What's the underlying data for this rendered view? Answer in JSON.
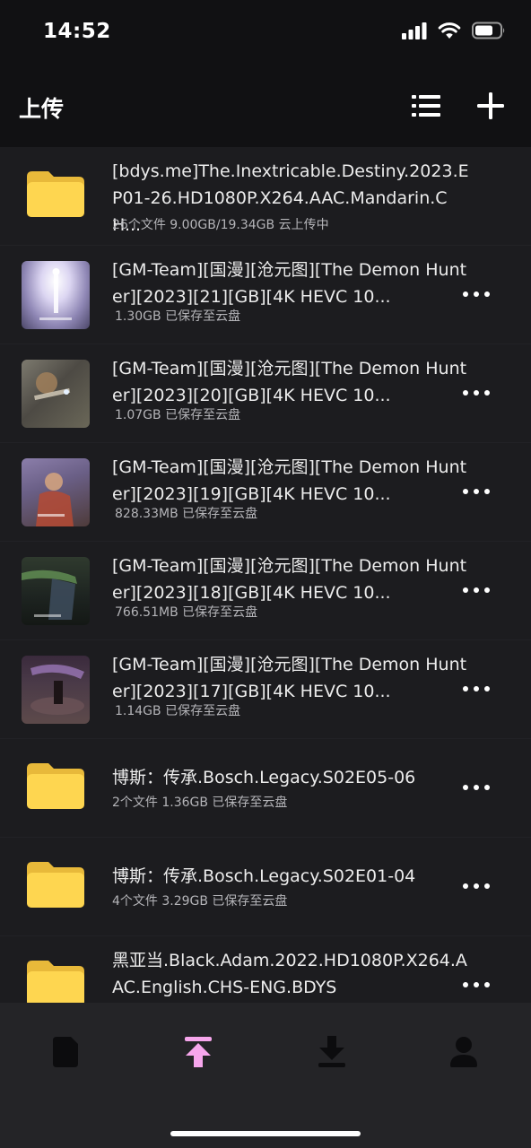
{
  "status_bar": {
    "time": "14:52"
  },
  "header": {
    "title": "上传"
  },
  "colors": {
    "accent": "#f6a6ec",
    "folder": "#fed650",
    "background": "#111113",
    "row": "#1c1c1f",
    "tabbar": "#242427"
  },
  "items": [
    {
      "type": "folder",
      "name": "[bdys.me]The.Inextricable.Destiny.2023.EP01-26.HD1080P.X264.AAC.Mandarin.CH...",
      "meta": "26个文件 9.00GB/19.34GB 云上传中"
    },
    {
      "type": "video",
      "name": "[GM-Team][国漫][沧元图][The Demon Hunter][2023][21][GB][4K HEVC 10...",
      "meta": "1.30GB 已保存至云盘"
    },
    {
      "type": "video",
      "name": "[GM-Team][国漫][沧元图][The Demon Hunter][2023][20][GB][4K HEVC 10...",
      "meta": "1.07GB 已保存至云盘"
    },
    {
      "type": "video",
      "name": "[GM-Team][国漫][沧元图][The Demon Hunter][2023][19][GB][4K HEVC 10...",
      "meta": "828.33MB 已保存至云盘"
    },
    {
      "type": "video",
      "name": "[GM-Team][国漫][沧元图][The Demon Hunter][2023][18][GB][4K HEVC 10...",
      "meta": "766.51MB 已保存至云盘"
    },
    {
      "type": "video",
      "name": "[GM-Team][国漫][沧元图][The Demon Hunter][2023][17][GB][4K HEVC 10...",
      "meta": "1.14GB 已保存至云盘"
    },
    {
      "type": "folder",
      "name": "博斯：传承.Bosch.Legacy.S02E05-06",
      "meta": "2个文件 1.36GB 已保存至云盘"
    },
    {
      "type": "folder",
      "name": "博斯：传承.Bosch.Legacy.S02E01-04",
      "meta": "4个文件 3.29GB 已保存至云盘"
    },
    {
      "type": "folder",
      "name": "黑亚当.Black.Adam.2022.HD1080P.X264.AAC.English.CHS-ENG.BDYS",
      "meta": ""
    }
  ],
  "tabs": [
    {
      "icon": "file-icon",
      "active": false
    },
    {
      "icon": "upload-icon",
      "active": true
    },
    {
      "icon": "download-icon",
      "active": false
    },
    {
      "icon": "profile-icon",
      "active": false
    }
  ]
}
